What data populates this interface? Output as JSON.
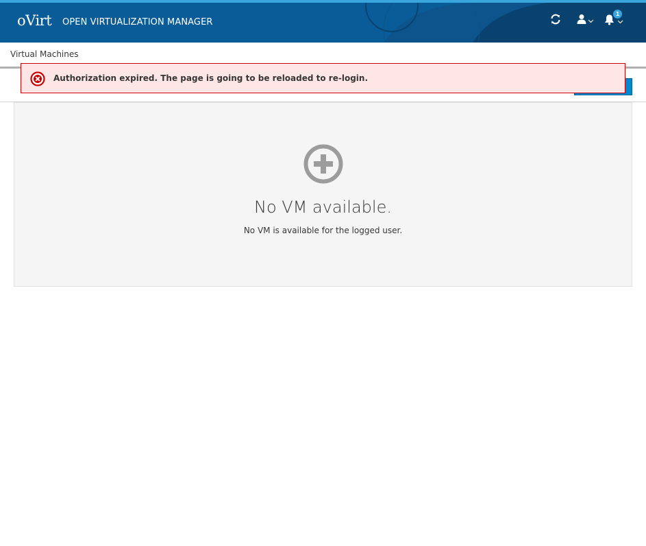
{
  "masthead": {
    "logo": "oVirt",
    "title": "OPEN VIRTUALIZATION MANAGER",
    "notification_count": "1",
    "icons": {
      "refresh": "refresh-icon",
      "user": "user-icon",
      "notifications": "bell-icon"
    },
    "colors": {
      "background": "#0a5c99",
      "accent": "#39a5dc"
    }
  },
  "breadcrumb": {
    "label": "Virtual Machines"
  },
  "alert": {
    "type": "error",
    "icon": "error-circle-icon",
    "message": "Authorization expired. The page is going to be reloaded to re-login.",
    "colors": {
      "background": "#ffe6e6",
      "border": "#cc0000"
    }
  },
  "empty_state": {
    "icon": "add-circle-icon",
    "title": "No VM available.",
    "description": "No VM is available for the logged user."
  }
}
